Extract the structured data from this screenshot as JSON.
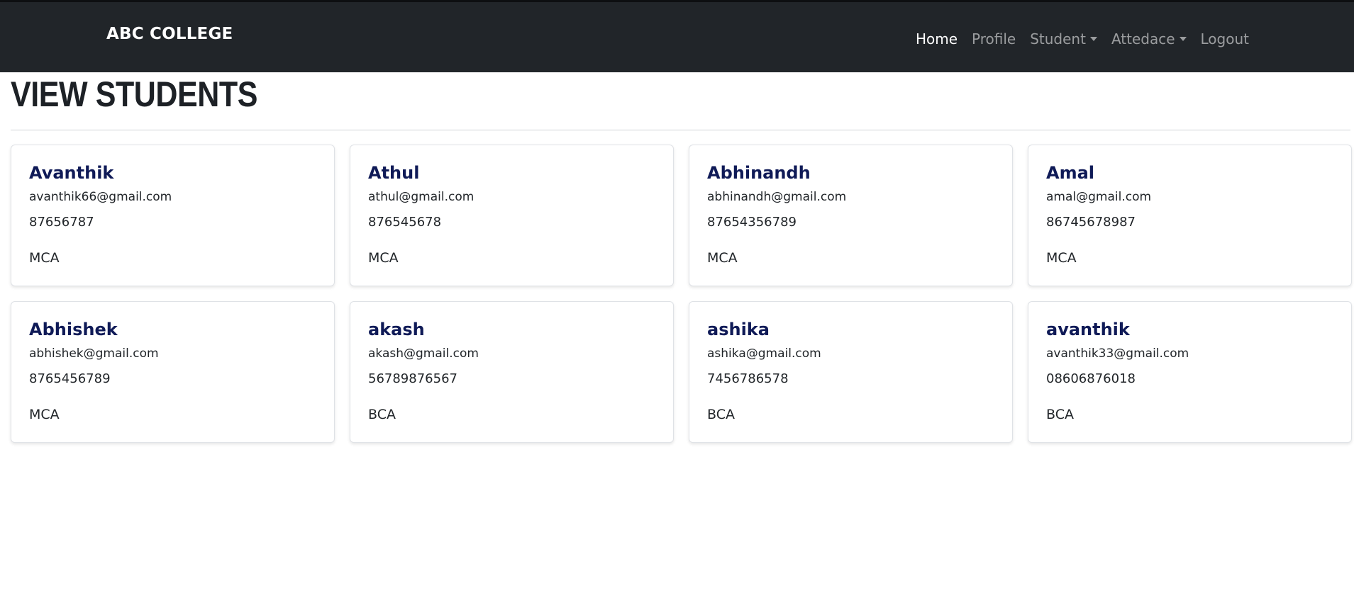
{
  "navbar": {
    "brand": "ABC COLLEGE",
    "links": [
      {
        "label": "Home",
        "active": true,
        "dropdown": false
      },
      {
        "label": "Profile",
        "active": false,
        "dropdown": false
      },
      {
        "label": "Student",
        "active": false,
        "dropdown": true
      },
      {
        "label": "Attedace",
        "active": false,
        "dropdown": true
      },
      {
        "label": "Logout",
        "active": false,
        "dropdown": false
      }
    ]
  },
  "page": {
    "title": "VIEW STUDENTS"
  },
  "students": [
    {
      "name": "Avanthik",
      "email": "avanthik66@gmail.com",
      "phone": "87656787",
      "course": "MCA"
    },
    {
      "name": "Athul",
      "email": "athul@gmail.com",
      "phone": "876545678",
      "course": "MCA"
    },
    {
      "name": "Abhinandh",
      "email": "abhinandh@gmail.com",
      "phone": "87654356789",
      "course": "MCA"
    },
    {
      "name": "Amal",
      "email": "amal@gmail.com",
      "phone": "86745678987",
      "course": "MCA"
    },
    {
      "name": "Abhishek",
      "email": "abhishek@gmail.com",
      "phone": "8765456789",
      "course": "MCA"
    },
    {
      "name": "akash",
      "email": "akash@gmail.com",
      "phone": "56789876567",
      "course": "BCA"
    },
    {
      "name": "ashika",
      "email": "ashika@gmail.com",
      "phone": "7456786578",
      "course": "BCA"
    },
    {
      "name": "avanthik",
      "email": "avanthik33@gmail.com",
      "phone": "08606876018",
      "course": "BCA"
    }
  ],
  "colors": {
    "navbar_bg": "#212529",
    "name_color": "#0f1a57"
  }
}
